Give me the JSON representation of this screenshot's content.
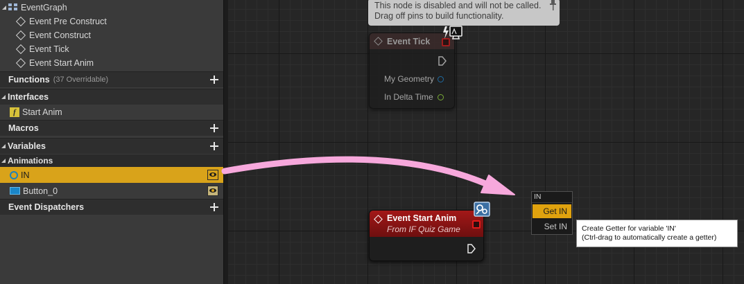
{
  "my_blueprint": {
    "graph_root": "EventGraph",
    "events": [
      "Event Pre Construct",
      "Event Construct",
      "Event Tick",
      "Event Start Anim"
    ],
    "functions": {
      "label": "Functions",
      "count": "(37 Overridable)"
    },
    "interfaces": {
      "label": "Interfaces",
      "items": [
        "Start Anim"
      ]
    },
    "macros": {
      "label": "Macros"
    },
    "variables": {
      "label": "Variables",
      "category": "Animations",
      "items": [
        {
          "name": "IN",
          "selected": true,
          "type_color": "#2f9bd4"
        },
        {
          "name": "Button_0",
          "selected": false,
          "type_color": "#1a86c8"
        }
      ]
    },
    "event_dispatchers": {
      "label": "Event Dispatchers"
    }
  },
  "graph": {
    "disabled_tooltip": {
      "line1": "This node is disabled and will not be called.",
      "line2": "Drag off pins to build functionality."
    },
    "event_tick_node": {
      "title": "Event Tick",
      "pins": [
        "My Geometry",
        "In Delta Time"
      ],
      "header_color": "#3d2a2a"
    },
    "start_anim_node": {
      "title": "Event Start Anim",
      "subtitle": "From IF Quiz Game",
      "header_color": "#8a1414"
    },
    "context_menu": {
      "header": "IN",
      "items": [
        "Get IN",
        "Set IN"
      ],
      "selected": "Get IN"
    },
    "hover_tooltip": {
      "line1": "Create Getter for variable 'IN'",
      "line2": "(Ctrl-drag to automatically create a getter)"
    },
    "drag_arrow_color": "#f7a8dc"
  }
}
